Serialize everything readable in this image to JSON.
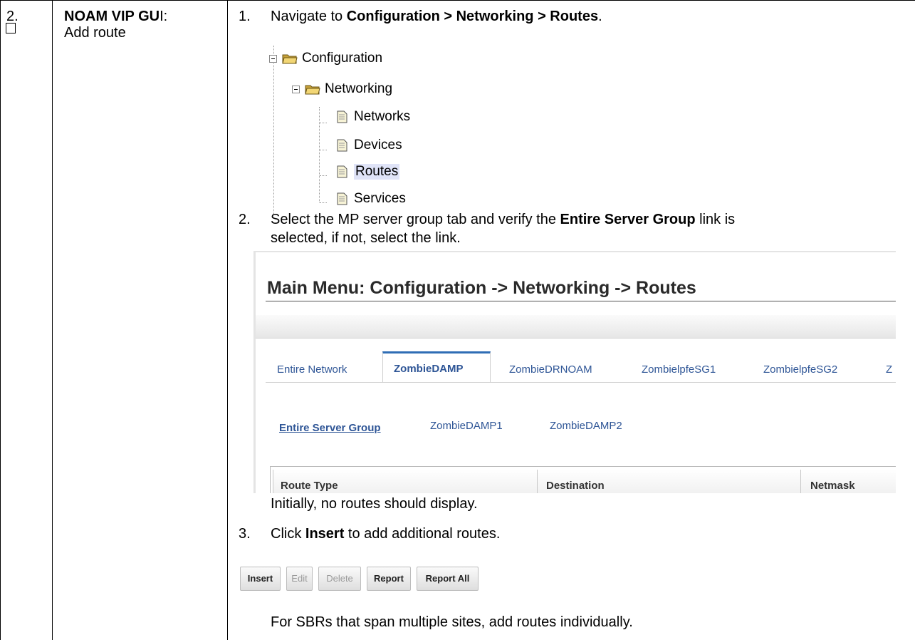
{
  "step": {
    "number": "2.",
    "title_bold": "NOAM VIP GU",
    "title_rest": "I:",
    "subtitle": "Add route"
  },
  "instructions": {
    "i1_num": "1.",
    "i1_pre": "Navigate to ",
    "i1_bold": "Configuration > Networking > Routes",
    "i1_post": ".",
    "i2_num": "2.",
    "i2_line1_pre": "Select the MP server group tab and verify the ",
    "i2_line1_bold": "Entire Server Group",
    "i2_line1_post": " link is",
    "i2_line2": "selected, if not, select the link.",
    "note1": "Initially, no routes should display.",
    "i3_num": "3.",
    "i3_pre": "Click ",
    "i3_bold": "Insert",
    "i3_post": " to add additional routes.",
    "note2": "For SBRs that span multiple sites, add routes individually."
  },
  "tree": {
    "configuration": "Configuration",
    "networking": "Networking",
    "networks": "Networks",
    "devices": "Devices",
    "routes": "Routes",
    "services": "Services"
  },
  "screen": {
    "title": "Main Menu: Configuration -> Networking -> Routes",
    "tabs": [
      "Entire Network",
      "ZombieDAMP",
      "ZombieDRNOAM",
      "ZombielpfeSG1",
      "ZombielpfeSG2",
      "Z"
    ],
    "active_tab": "ZombieDAMP",
    "subtabs": [
      "Entire Server Group",
      "ZombieDAMP1",
      "ZombieDAMP2"
    ],
    "columns": [
      "Route Type",
      "Destination",
      "Netmask"
    ]
  },
  "buttons": {
    "insert": "Insert",
    "edit": "Edit",
    "delete": "Delete",
    "report": "Report",
    "report_all": "Report All"
  },
  "colors": {
    "link": "#2e5596",
    "tab_active_border": "#2f6db5",
    "tree_highlight": "#dfe3f7"
  }
}
